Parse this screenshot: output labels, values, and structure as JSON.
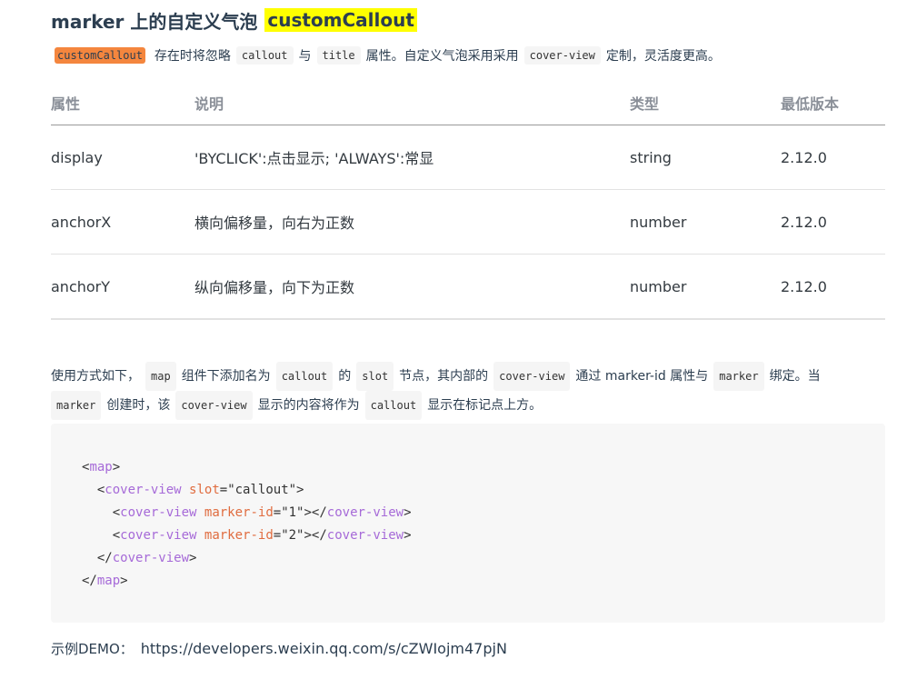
{
  "heading": {
    "prefix": "marker 上的自定义气泡",
    "highlight": "customCallout"
  },
  "intro": {
    "code_custom": "customCallout",
    "text1": "存在时将忽略",
    "code_callout": "callout",
    "text2": "与",
    "code_title": "title",
    "text3": "属性。自定义气泡采用采用",
    "code_coverview": "cover-view",
    "text4": "定制，灵活度更高。"
  },
  "table": {
    "headers": [
      "属性",
      "说明",
      "类型",
      "最低版本"
    ],
    "rows": [
      [
        "display",
        "'BYCLICK':点击显示; 'ALWAYS':常显",
        "string",
        "2.12.0"
      ],
      [
        "anchorX",
        "横向偏移量，向右为正数",
        "number",
        "2.12.0"
      ],
      [
        "anchorY",
        "纵向偏移量，向下为正数",
        "number",
        "2.12.0"
      ]
    ]
  },
  "usage": {
    "t1": "使用方式如下，",
    "c_map": "map",
    "t2": "组件下添加名为",
    "c_callout": "callout",
    "t3": "的",
    "c_slot": "slot",
    "t4": "节点，其内部的",
    "c_coverview": "cover-view",
    "t5": "通过 marker-id 属性与",
    "c_marker": "marker",
    "t6": "绑定。当",
    "c_marker2": "marker",
    "t7": "创建时，该",
    "c_coverview2": "cover-view",
    "t8": "显示的内容将作为",
    "c_callout2": "callout",
    "t9": "显示在标记点上方。"
  },
  "code": {
    "map_tag": "map",
    "cover_tag": "cover-view",
    "slot_attr": "slot",
    "slot_val": "\"callout\"",
    "marker_attr": "marker-id",
    "marker_val1": "\"1\"",
    "marker_val2": "\"2\""
  },
  "demo": {
    "label": "示例DEMO：",
    "url": "https://developers.weixin.qq.com/s/cZWIojm47pjN"
  },
  "colors": {
    "highlight_yellow": "#ffff00",
    "code_orange": "#f4863e",
    "version_link": "#576b95",
    "tag_purple": "#a66ad8",
    "attr_orange": "#e06c3f"
  }
}
